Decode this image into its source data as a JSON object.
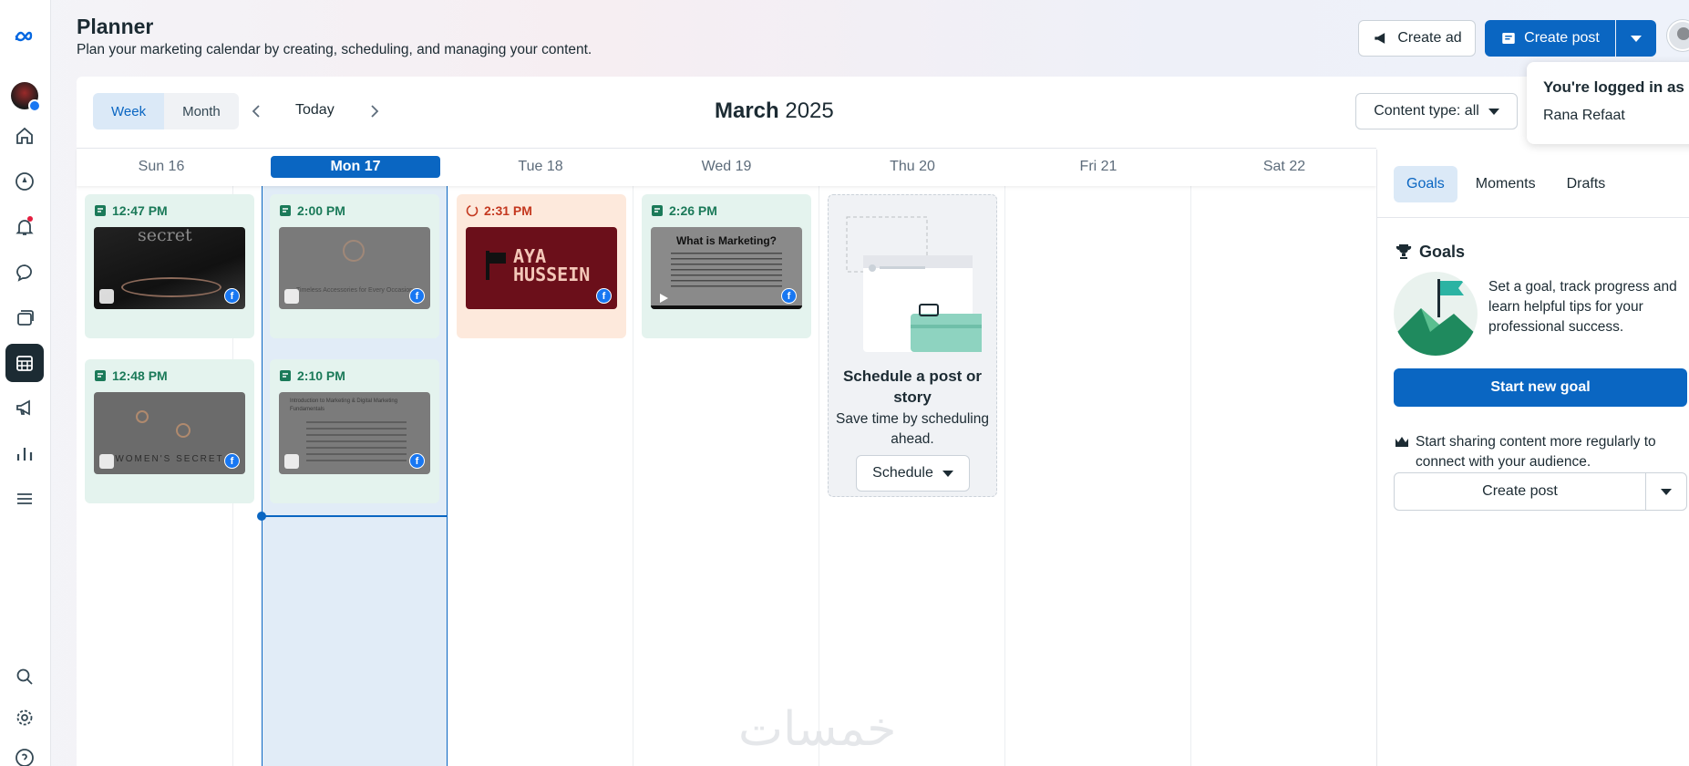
{
  "header": {
    "title": "Planner",
    "subtitle": "Plan your marketing calendar by creating, scheduling, and managing your content.",
    "create_ad": "Create ad",
    "create_post": "Create post"
  },
  "tooltip": {
    "title": "You're logged in as",
    "name": "Rana Refaat"
  },
  "toolbar": {
    "week": "Week",
    "month": "Month",
    "today": "Today",
    "month_name": "March",
    "year": "2025",
    "content_type": "Content type: all"
  },
  "days": [
    "Sun 16",
    "Mon 17",
    "Tue 18",
    "Wed 19",
    "Thu 20",
    "Fri 21",
    "Sat 22"
  ],
  "posts": [
    {
      "time": "12:47 PM",
      "status": "scheduled",
      "thumb_text": "secret"
    },
    {
      "time": "12:48 PM",
      "status": "scheduled",
      "thumb_text": "WOMEN'S SECRET"
    },
    {
      "time": "2:00 PM",
      "status": "scheduled",
      "thumb_text": "Timeless Accessories for Every Occasion"
    },
    {
      "time": "2:10 PM",
      "status": "scheduled",
      "thumb_text": "Introduction to Marketing & Digital Marketing Fundamentals"
    },
    {
      "time": "2:31 PM",
      "status": "failed",
      "thumb_text": "AYA HUSSEIN"
    },
    {
      "time": "2:26 PM",
      "status": "scheduled",
      "thumb_text": "What is Marketing?"
    }
  ],
  "empty_slot": {
    "title": "Schedule a post or story",
    "subtitle": "Save time by scheduling ahead.",
    "button": "Schedule"
  },
  "side": {
    "tabs": [
      "Goals",
      "Moments",
      "Drafts"
    ],
    "goals_heading": "Goals",
    "goal_text": "Set a goal, track progress and learn helpful tips for your professional success.",
    "start_goal": "Start new goal",
    "share_tip": "Start sharing content more regularly to connect with your audience.",
    "create_post": "Create post"
  },
  "watermark": "خمسات",
  "colors": {
    "accent": "#0a66c2",
    "scheduled_bg": "#e4f3ee",
    "failed_bg": "#fde9dc",
    "today_col": "#e1ecf7"
  }
}
